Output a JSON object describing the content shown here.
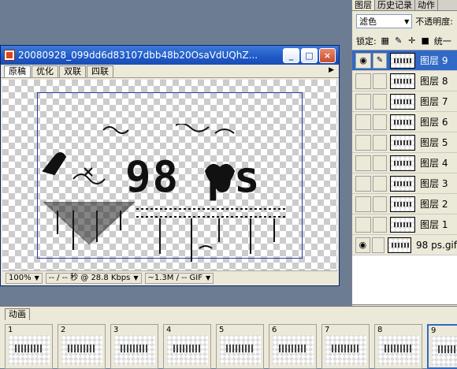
{
  "document": {
    "title": "20080928_099dd6d83107dbb48b20OsaVdUQhZ...",
    "window_buttons": {
      "minimize": "_",
      "restore": "□",
      "close": "×"
    },
    "tabs": [
      "原稿",
      "优化",
      "双联",
      "四联"
    ],
    "active_tab": "原稿",
    "artwork_text": "98 ps",
    "status": {
      "zoom": "100%",
      "speed": "-- / -- 秒 @ 28.8 Kbps",
      "size": "~1.3M / -- GIF"
    }
  },
  "layers_panel": {
    "tabs": [
      "图层",
      "历史记录",
      "动作"
    ],
    "blend_mode": "滤色",
    "opacity_label": "不透明度:",
    "lock_label": "锁定:",
    "unify_label": "统一",
    "layers": [
      {
        "name": "图层 9",
        "visible": true,
        "selected": true
      },
      {
        "name": "图层 8",
        "visible": false,
        "selected": false
      },
      {
        "name": "图层 7",
        "visible": false,
        "selected": false
      },
      {
        "name": "图层 6",
        "visible": false,
        "selected": false
      },
      {
        "name": "图层 5",
        "visible": false,
        "selected": false
      },
      {
        "name": "图层 4",
        "visible": false,
        "selected": false
      },
      {
        "name": "图层 3",
        "visible": false,
        "selected": false
      },
      {
        "name": "图层 2",
        "visible": false,
        "selected": false
      },
      {
        "name": "图层 1",
        "visible": false,
        "selected": false
      },
      {
        "name": "98  ps.gif",
        "visible": true,
        "selected": false
      }
    ]
  },
  "animation_panel": {
    "tab": "动画",
    "frames": [
      "1",
      "2",
      "3",
      "4",
      "5",
      "6",
      "7",
      "8",
      "9"
    ],
    "selected_frame": "9"
  }
}
